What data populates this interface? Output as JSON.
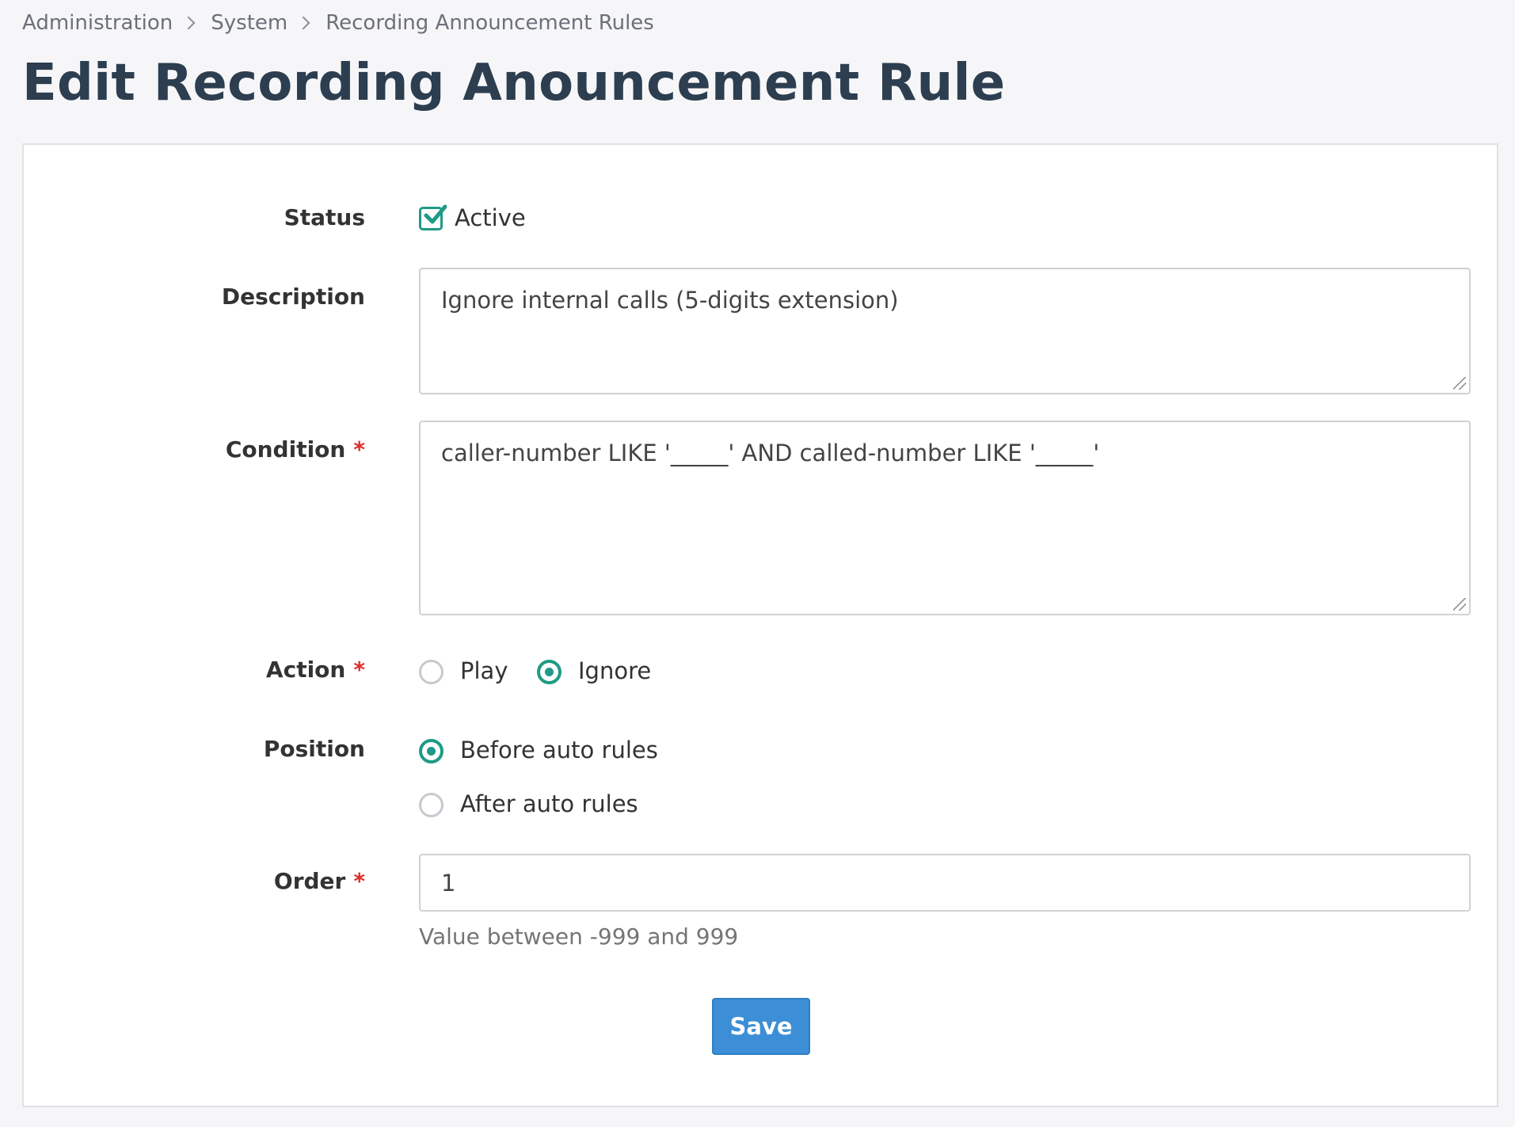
{
  "breadcrumb": [
    "Administration",
    "System",
    "Recording Announcement Rules"
  ],
  "page_title": "Edit Recording Anouncement Rule",
  "form": {
    "status": {
      "label": "Status",
      "checkbox_label": "Active",
      "checked": true
    },
    "description": {
      "label": "Description",
      "value": "Ignore internal calls (5-digits extension)"
    },
    "condition": {
      "label": "Condition",
      "required_mark": "*",
      "value": "caller-number LIKE '_____' AND called-number LIKE '_____'"
    },
    "action": {
      "label": "Action",
      "required_mark": "*",
      "options": [
        {
          "label": "Play",
          "selected": false
        },
        {
          "label": "Ignore",
          "selected": true
        }
      ]
    },
    "position": {
      "label": "Position",
      "options": [
        {
          "label": "Before auto rules",
          "selected": true
        },
        {
          "label": "After auto rules",
          "selected": false
        }
      ]
    },
    "order": {
      "label": "Order",
      "required_mark": "*",
      "value": "1",
      "help": "Value between -999 and 999"
    },
    "save_label": "Save"
  },
  "colors": {
    "accent": "#1f9a86",
    "primary_button": "#3c8fd6",
    "required": "#e02b2b",
    "title": "#2c3e50"
  }
}
